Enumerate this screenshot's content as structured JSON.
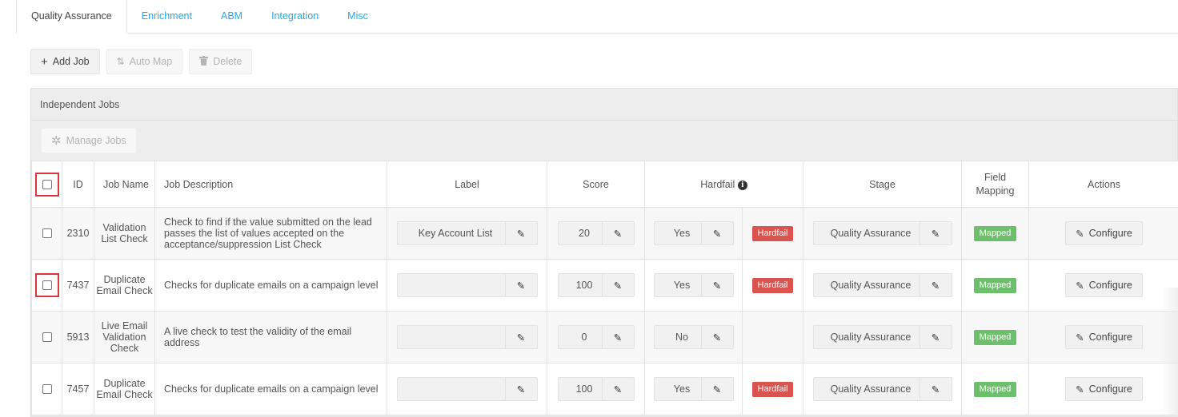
{
  "tabs": [
    {
      "label": "Quality Assurance",
      "active": true
    },
    {
      "label": "Enrichment"
    },
    {
      "label": "ABM"
    },
    {
      "label": "Integration"
    },
    {
      "label": "Misc"
    }
  ],
  "toolbar": {
    "add_job": "Add Job",
    "auto_map": "Auto Map",
    "delete": "Delete"
  },
  "panel": {
    "title": "Independent Jobs",
    "manage_jobs": "Manage Jobs"
  },
  "table": {
    "headers": {
      "id": "ID",
      "job_name": "Job Name",
      "job_description": "Job Description",
      "label": "Label",
      "score": "Score",
      "hardfail": "Hardfail",
      "stage": "Stage",
      "field_mapping": "Field Mapping",
      "actions": "Actions"
    },
    "rows": [
      {
        "id": "2310",
        "name": "Validation List Check",
        "description": "Check to find if the value submitted on the lead passes the list of values accepted on the acceptance/suppression List Check",
        "label": "Key Account List",
        "score": "20",
        "hardfail": "Yes",
        "hardfail_badge": "Hardfail",
        "stage": "Quality Assurance",
        "mapping": "Mapped",
        "action": "Configure"
      },
      {
        "id": "7437",
        "name": "Duplicate Email Check",
        "description": "Checks for duplicate emails on a campaign level",
        "label": "",
        "score": "100",
        "hardfail": "Yes",
        "hardfail_badge": "Hardfail",
        "stage": "Quality Assurance",
        "mapping": "Mapped",
        "action": "Configure"
      },
      {
        "id": "5913",
        "name": "Live Email Validation Check",
        "description": "A live check to test the validity of the email address",
        "label": "",
        "score": "0",
        "hardfail": "No",
        "hardfail_badge": "",
        "stage": "Quality Assurance",
        "mapping": "Mapped",
        "action": "Configure"
      },
      {
        "id": "7457",
        "name": "Duplicate Email Check",
        "description": "Checks for duplicate emails on a campaign level",
        "label": "",
        "score": "100",
        "hardfail": "Yes",
        "hardfail_badge": "Hardfail",
        "stage": "Quality Assurance",
        "mapping": "Mapped",
        "action": "Configure"
      }
    ]
  },
  "colors": {
    "tab_link": "#2aa9e0",
    "hardfail_badge": "#d9534f",
    "mapped_badge": "#6ebf6b",
    "highlight_box": "#d9363e"
  }
}
